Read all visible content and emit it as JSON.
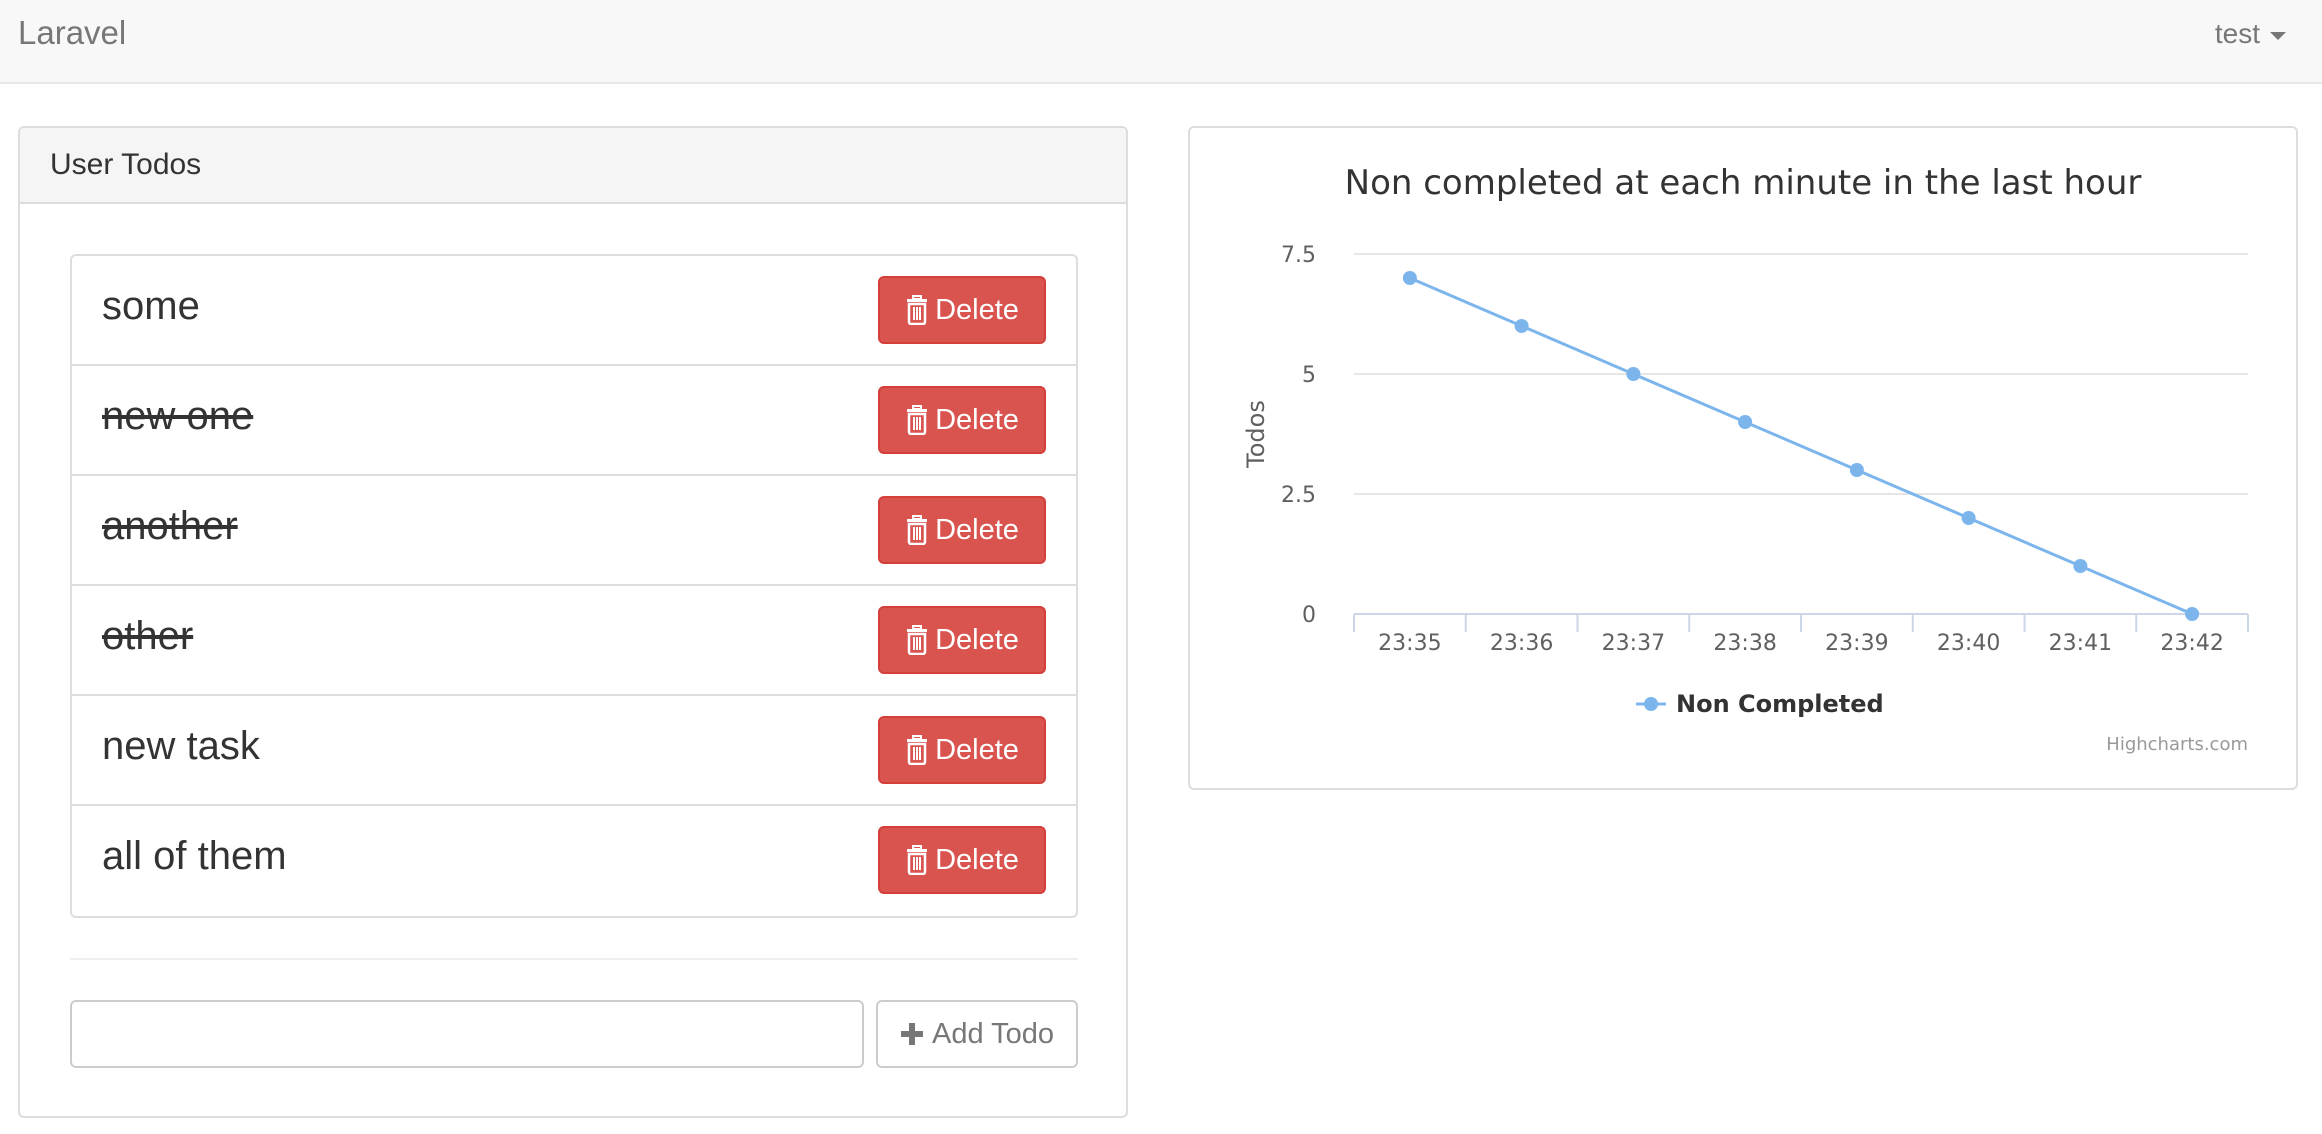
{
  "navbar": {
    "brand": "Laravel",
    "user": "test"
  },
  "todos_panel": {
    "title": "User Todos",
    "items": [
      {
        "text": "some",
        "done": false
      },
      {
        "text": "new one",
        "done": true
      },
      {
        "text": "another",
        "done": true
      },
      {
        "text": "other",
        "done": true
      },
      {
        "text": "new task",
        "done": false
      },
      {
        "text": "all of them",
        "done": false
      }
    ],
    "delete_label": "Delete",
    "input_value": "",
    "add_label": "Add Todo"
  },
  "chart_data": {
    "type": "line",
    "title": "Non completed at each minute in the last hour",
    "xlabel": "",
    "ylabel": "Todos",
    "categories": [
      "23:35",
      "23:36",
      "23:37",
      "23:38",
      "23:39",
      "23:40",
      "23:41",
      "23:42"
    ],
    "y_ticks": [
      "0",
      "2.5",
      "5",
      "7.5"
    ],
    "ylim": [
      0,
      7.5
    ],
    "series": [
      {
        "name": "Non Completed",
        "values": [
          7,
          6,
          5,
          4,
          3,
          2,
          1,
          0
        ],
        "color": "#7cb5ec"
      }
    ],
    "grid": true,
    "legend": "bottom-center",
    "credits": "Highcharts.com"
  },
  "colors": {
    "danger": "#d9534f",
    "series": "#7cb5ec"
  }
}
